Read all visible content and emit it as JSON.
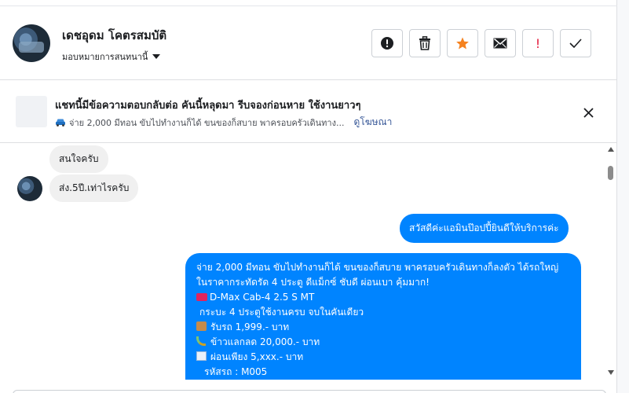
{
  "header": {
    "name": "เดชอุดม โคตรสมบัติ",
    "assign_label": "มอบหมายการสนทนานี้"
  },
  "actions": [
    {
      "name": "report-icon",
      "color": "#1c1e21"
    },
    {
      "name": "trash-icon",
      "color": "#1c1e21"
    },
    {
      "name": "star-icon",
      "color": "#f5821f"
    },
    {
      "name": "mail-icon",
      "color": "#1c1e21"
    },
    {
      "name": "important-icon",
      "color": "#e41e3f",
      "glyph": "!"
    },
    {
      "name": "checkmark-icon",
      "color": "#1c1e21"
    }
  ],
  "banner": {
    "title": "แชทนี้มีข้อความตอบกลับต่อ คันนี้หลุดมา รีบจองก่อนหาย ใช้งานยาวๆ",
    "subtitle": "จ่าย 2,000 มีทอน ขับไปทำงานก็ได้ ขนของก็สบาย พาครอบครัวเดินทาง...",
    "link": "ดูโฆษณา"
  },
  "messages": {
    "incoming_1": "สนใจครับ",
    "incoming_2": "ส่ง.5ปี.เท่าไรครับ",
    "outgoing_1": "สวัสดีค่ะแอมินป๊อปปี้ยินดีให้บริการค่ะ",
    "outgoing_2": {
      "line1": "จ่าย 2,000 มีทอน ขับไปทำงานก็ได้ ขนของก็สบาย พาครอบครัวเดินทางก็ลงตัว ได้รถใหญ่ ในราคากระทัดรัด 4 ประตู ดีแม็กซ์ ชับดี ผ่อนเบา คุ้มมาก!",
      "line2": "D-Max Cab-4 2.5 S MT",
      "line3": "กระบะ 4 ประตูใช้งานครบ จบในคันเดียว",
      "line4": "รับรถ 1,999.- บาท",
      "line5": "ข้าวแลกลด 20,000.- บาท",
      "line6": "ผ่อนเพียง 5,xxx.- บาท",
      "line7": "รหัสรถ : M005"
    }
  },
  "colors": {
    "accent": "#0084ff",
    "link": "#385898"
  }
}
